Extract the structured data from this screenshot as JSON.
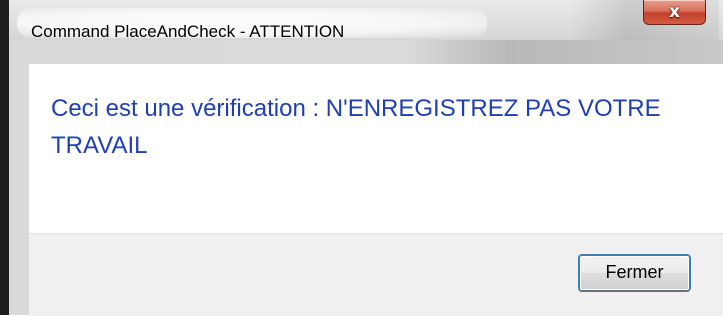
{
  "window": {
    "title": "Command PlaceAndCheck - ATTENTION",
    "close_glyph": "x"
  },
  "dialog": {
    "message": "Ceci est une vérification : N'ENREGISTREZ PAS VOTRE TRAVAIL",
    "close_button_label": "Fermer"
  },
  "colors": {
    "message_text": "#1f3fb5",
    "close_button_red": "#c4412b",
    "footer_bg": "#f0f0f0"
  },
  "icons": {
    "close": "close-icon"
  }
}
